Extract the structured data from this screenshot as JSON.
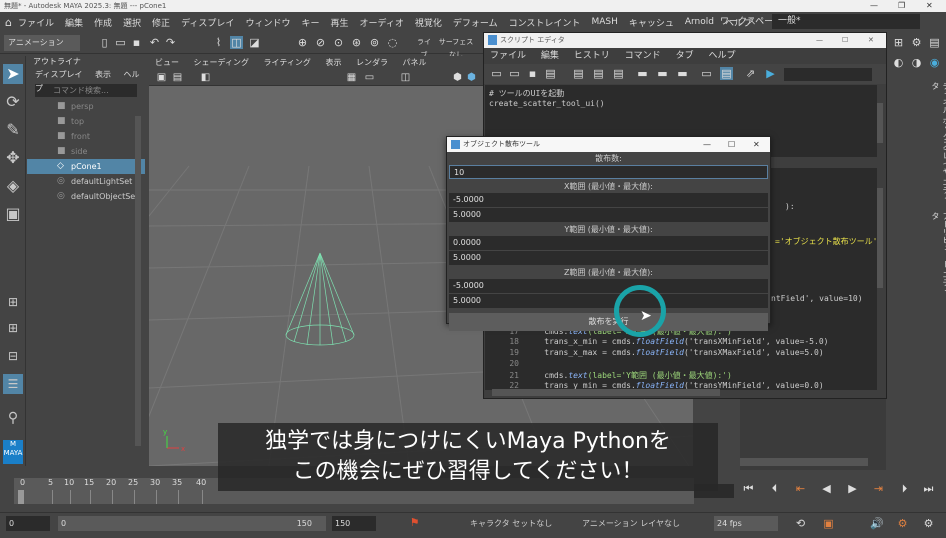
{
  "titlebar": {
    "text": "無題* - Autodesk MAYA 2025.3: 無題  ---  pCone1"
  },
  "menubar": {
    "items": [
      "ファイル",
      "編集",
      "作成",
      "選択",
      "修正",
      "ディスプレイ",
      "ウィンドウ",
      "キー",
      "再生",
      "オーディオ",
      "視覚化",
      "デフォーム",
      "コンストレイント",
      "MASH",
      "キャッシュ",
      "Arnold",
      "ヘルプ"
    ],
    "workspace_label": "ワークスペース:",
    "workspace_value": "一般*"
  },
  "toolbar": {
    "mode": "アニメーション",
    "live_label": "ライブ",
    "surface_label": "サーフェスなし"
  },
  "outliner": {
    "title": "アウトライナ",
    "menus": [
      "ディスプレイ",
      "表示",
      "ヘルプ"
    ],
    "search_placeholder": "コマンド検索...",
    "items": [
      {
        "label": "persp",
        "dim": true
      },
      {
        "label": "top",
        "dim": true
      },
      {
        "label": "front",
        "dim": true
      },
      {
        "label": "side",
        "dim": true
      },
      {
        "label": "pCone1",
        "dim": false
      },
      {
        "label": "defaultLightSet",
        "dim": false
      },
      {
        "label": "defaultObjectSet",
        "dim": false
      }
    ]
  },
  "viewport": {
    "menus": [
      "ビュー",
      "シェーディング",
      "ライティング",
      "表示",
      "レンダラ",
      "パネル"
    ]
  },
  "scripted": {
    "title": "スクリプト エディタ",
    "menus": [
      "ファイル",
      "編集",
      "ヒストリ",
      "コマンド",
      "タブ",
      "ヘルプ"
    ],
    "history": [
      "# ツールのUIを起動",
      "create_scatter_tool_ui()"
    ],
    "code_fragments": {
      "f1": "):",
      "f2": "='オブジェクト散布ツール',",
      "f3": "ntField', value=10)"
    },
    "code_lines": [
      {
        "n": "17",
        "pre": "    cmds.",
        "fn": "text",
        "post": "(label='X範囲 (最小値・最大値):')"
      },
      {
        "n": "18",
        "pre": "    trans_x_min = cmds.",
        "fn": "floatField",
        "post": "('transXMinField', value=-5.0)"
      },
      {
        "n": "19",
        "pre": "    trans_x_max = cmds.",
        "fn": "floatField",
        "post": "('transXMaxField', value=5.0)"
      },
      {
        "n": "20",
        "pre": "",
        "fn": "",
        "post": ""
      },
      {
        "n": "21",
        "pre": "    cmds.",
        "fn": "text",
        "post": "(label='Y範囲 (最小値・最大値):')"
      },
      {
        "n": "22",
        "pre": "    trans_y_min = cmds.",
        "fn": "floatField",
        "post": "('transYMinField', value=0.0)"
      }
    ]
  },
  "dialog": {
    "title": "オブジェクト散布ツール",
    "count_label": "散布数:",
    "count_value": "10",
    "x_label": "X範囲 (最小値・最大値):",
    "x_min": "-5.0000",
    "x_max": "5.0000",
    "y_label": "Y範囲 (最小値・最大値):",
    "y_min": "0.0000",
    "y_max": "5.0000",
    "z_label": "Z範囲 (最小値・最大値):",
    "z_min": "-5.0000",
    "z_max": "5.0000",
    "run_button": "散布を実行"
  },
  "right_tabs": [
    "チャネル ボックス/レイヤ エディタ",
    "アトリビュート エディタ"
  ],
  "timeline": {
    "ticks": [
      "0",
      "5",
      "10",
      "15",
      "20",
      "25",
      "30",
      "35",
      "40"
    ],
    "current": "0"
  },
  "range": {
    "start": "0",
    "inner_start": "0",
    "inner_end": "150",
    "end": "150",
    "char_set": "キャラクタ セットなし",
    "anim_layer": "アニメーション レイヤなし",
    "fps": "24 fps"
  },
  "subtitle": {
    "line1": "独学では身につけにくいMaya Pythonを",
    "line2": "この機会にぜひ習得してください！"
  },
  "maya_logo": "MAYA",
  "colors": {
    "accent": "#5285a6",
    "cursor_ring": "#1aa3a8",
    "cone": "#7ee0b0"
  }
}
